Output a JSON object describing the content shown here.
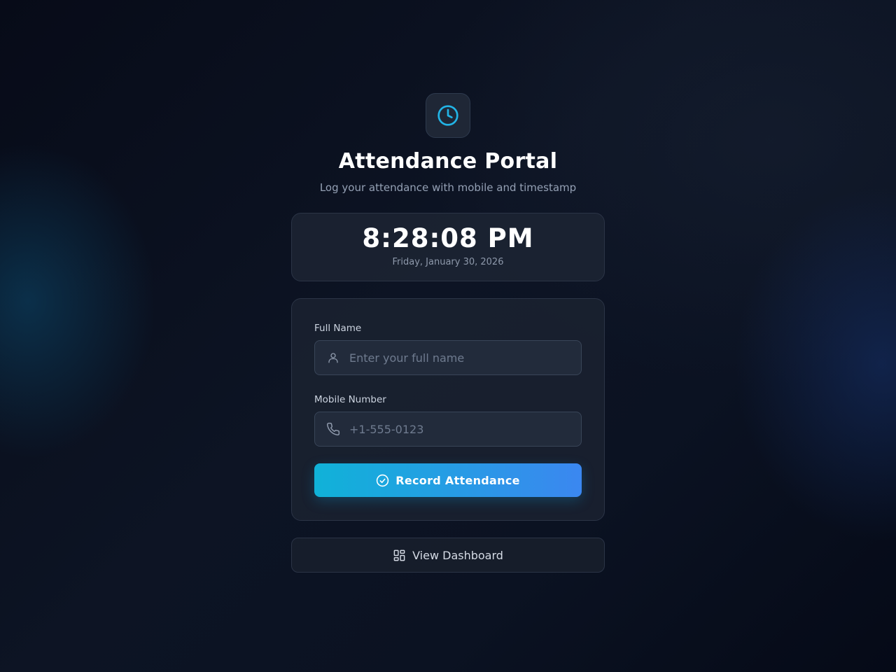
{
  "header": {
    "logo_icon": "clock-icon",
    "title": "Attendance Portal",
    "subtitle": "Log your attendance with mobile and timestamp"
  },
  "clock": {
    "time": "8:28:08 PM",
    "date": "Friday, January 30, 2026"
  },
  "form": {
    "name_label": "Full Name",
    "name_placeholder": "Enter your full name",
    "name_value": "",
    "name_icon": "user-icon",
    "mobile_label": "Mobile Number",
    "mobile_placeholder": "+1-555-0123",
    "mobile_value": "",
    "mobile_icon": "phone-icon",
    "submit_label": "Record Attendance",
    "submit_icon": "check-circle-icon"
  },
  "dashboard": {
    "label": "View Dashboard",
    "icon": "dashboard-grid-icon"
  },
  "colors": {
    "accent": "#22b4e6",
    "button_gradient_start": "#10b2d8",
    "button_gradient_end": "#3b87f0",
    "background": "#0b1222"
  }
}
